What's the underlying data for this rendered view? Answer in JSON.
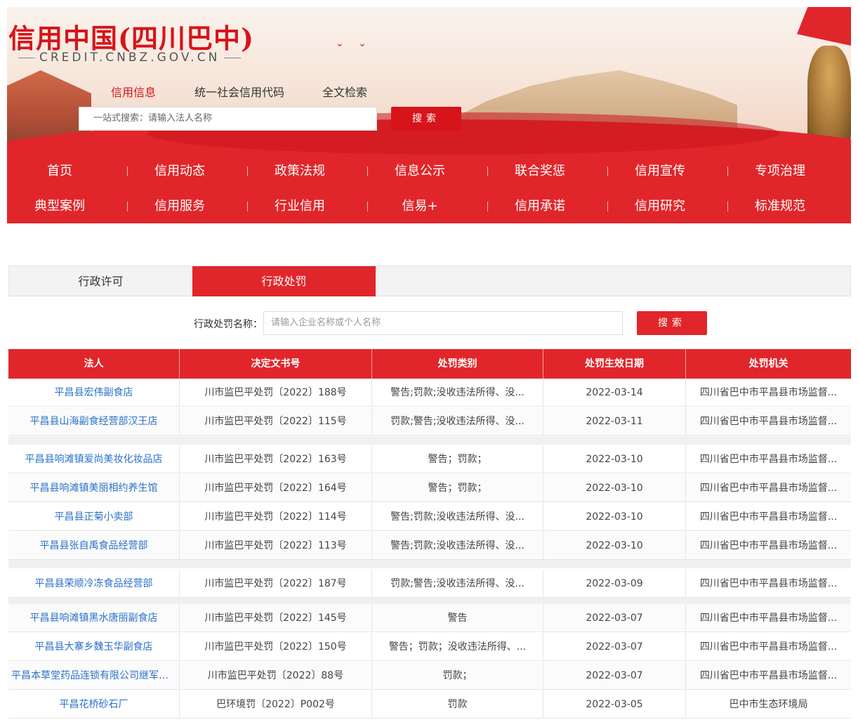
{
  "header": {
    "logo_title": "信用中国(四川巴中)",
    "logo_subtitle": "CREDIT.CNBZ.GOV.CN",
    "search_tabs": [
      {
        "label": "信用信息",
        "active": true
      },
      {
        "label": "统一社会信用代码",
        "active": false
      },
      {
        "label": "全文检索",
        "active": false
      }
    ],
    "search_placeholder": "一站式搜索：请输入法人名称",
    "search_button": "搜索"
  },
  "nav": {
    "row1": [
      "首页",
      "信用动态",
      "政策法规",
      "信息公示",
      "联合奖惩",
      "信用宣传",
      "专项治理"
    ],
    "row2": [
      "典型案例",
      "信用服务",
      "行业信用",
      "信易+",
      "信用承诺",
      "信用研究",
      "标准规范"
    ]
  },
  "tabs": [
    {
      "label": "行政许可",
      "active": false
    },
    {
      "label": "行政处罚",
      "active": true
    }
  ],
  "filter": {
    "label": "行政处罚名称：",
    "placeholder": "请输入企业名称或个人名称",
    "button": "搜索"
  },
  "table": {
    "columns": [
      "法人",
      "决定文书号",
      "处罚类别",
      "处罚生效日期",
      "处罚机关"
    ],
    "rows": [
      [
        "平昌县宏伟副食店",
        "川市监巴平处罚〔2022〕188号",
        "警告;罚款;没收违法所得、没...",
        "2022-03-14",
        "四川省巴中市平昌县市场监督..."
      ],
      [
        "平昌县山海副食经营部汉王店",
        "川市监巴平处罚〔2022〕115号",
        "罚款;警告;没收违法所得、没...",
        "2022-03-11",
        "四川省巴中市平昌县市场监督..."
      ],
      [
        "平昌县响滩镇爱尚美妆化妆品店",
        "川市监巴平处罚〔2022〕163号",
        "警告；罚款；",
        "2022-03-10",
        "四川省巴中市平昌县市场监督..."
      ],
      [
        "平昌县响滩镇美丽相约养生馆",
        "川市监巴平处罚〔2022〕164号",
        "警告；罚款；",
        "2022-03-10",
        "四川省巴中市平昌县市场监督..."
      ],
      [
        "平昌县正菊小卖部",
        "川市监巴平处罚〔2022〕114号",
        "警告;罚款;没收违法所得、没...",
        "2022-03-10",
        "四川省巴中市平昌县市场监督..."
      ],
      [
        "平昌县张自禹食品经营部",
        "川市监巴平处罚〔2022〕113号",
        "警告;罚款;没收违法所得、没...",
        "2022-03-10",
        "四川省巴中市平昌县市场监督..."
      ],
      [
        "平昌县荣顺冷冻食品经营部",
        "川市监巴平处罚〔2022〕187号",
        "罚款;警告;没收违法所得、没...",
        "2022-03-09",
        "四川省巴中市平昌县市场监督..."
      ],
      [
        "平昌县响滩镇黑水唐丽副食店",
        "川市监巴平处罚〔2022〕145号",
        "警告",
        "2022-03-07",
        "四川省巴中市平昌县市场监督..."
      ],
      [
        "平昌县大寨乡魏玉华副食店",
        "川市监巴平处罚〔2022〕150号",
        "警告；罚款；没收违法所得、...",
        "2022-03-07",
        "四川省巴中市平昌县市场监督..."
      ],
      [
        "平昌本草堂药品连锁有限公司继军分店",
        "川市监巴平处罚〔2022〕88号",
        "罚款；",
        "2022-03-07",
        "四川省巴中市平昌县市场监督..."
      ],
      [
        "平昌花桥砂石厂",
        "巴环境罚〔2022〕P002号",
        "罚款",
        "2022-03-05",
        "巴中市生态环境局"
      ]
    ]
  },
  "colors": {
    "brand_red": "#e0262a",
    "link_blue": "#2a72c9"
  }
}
